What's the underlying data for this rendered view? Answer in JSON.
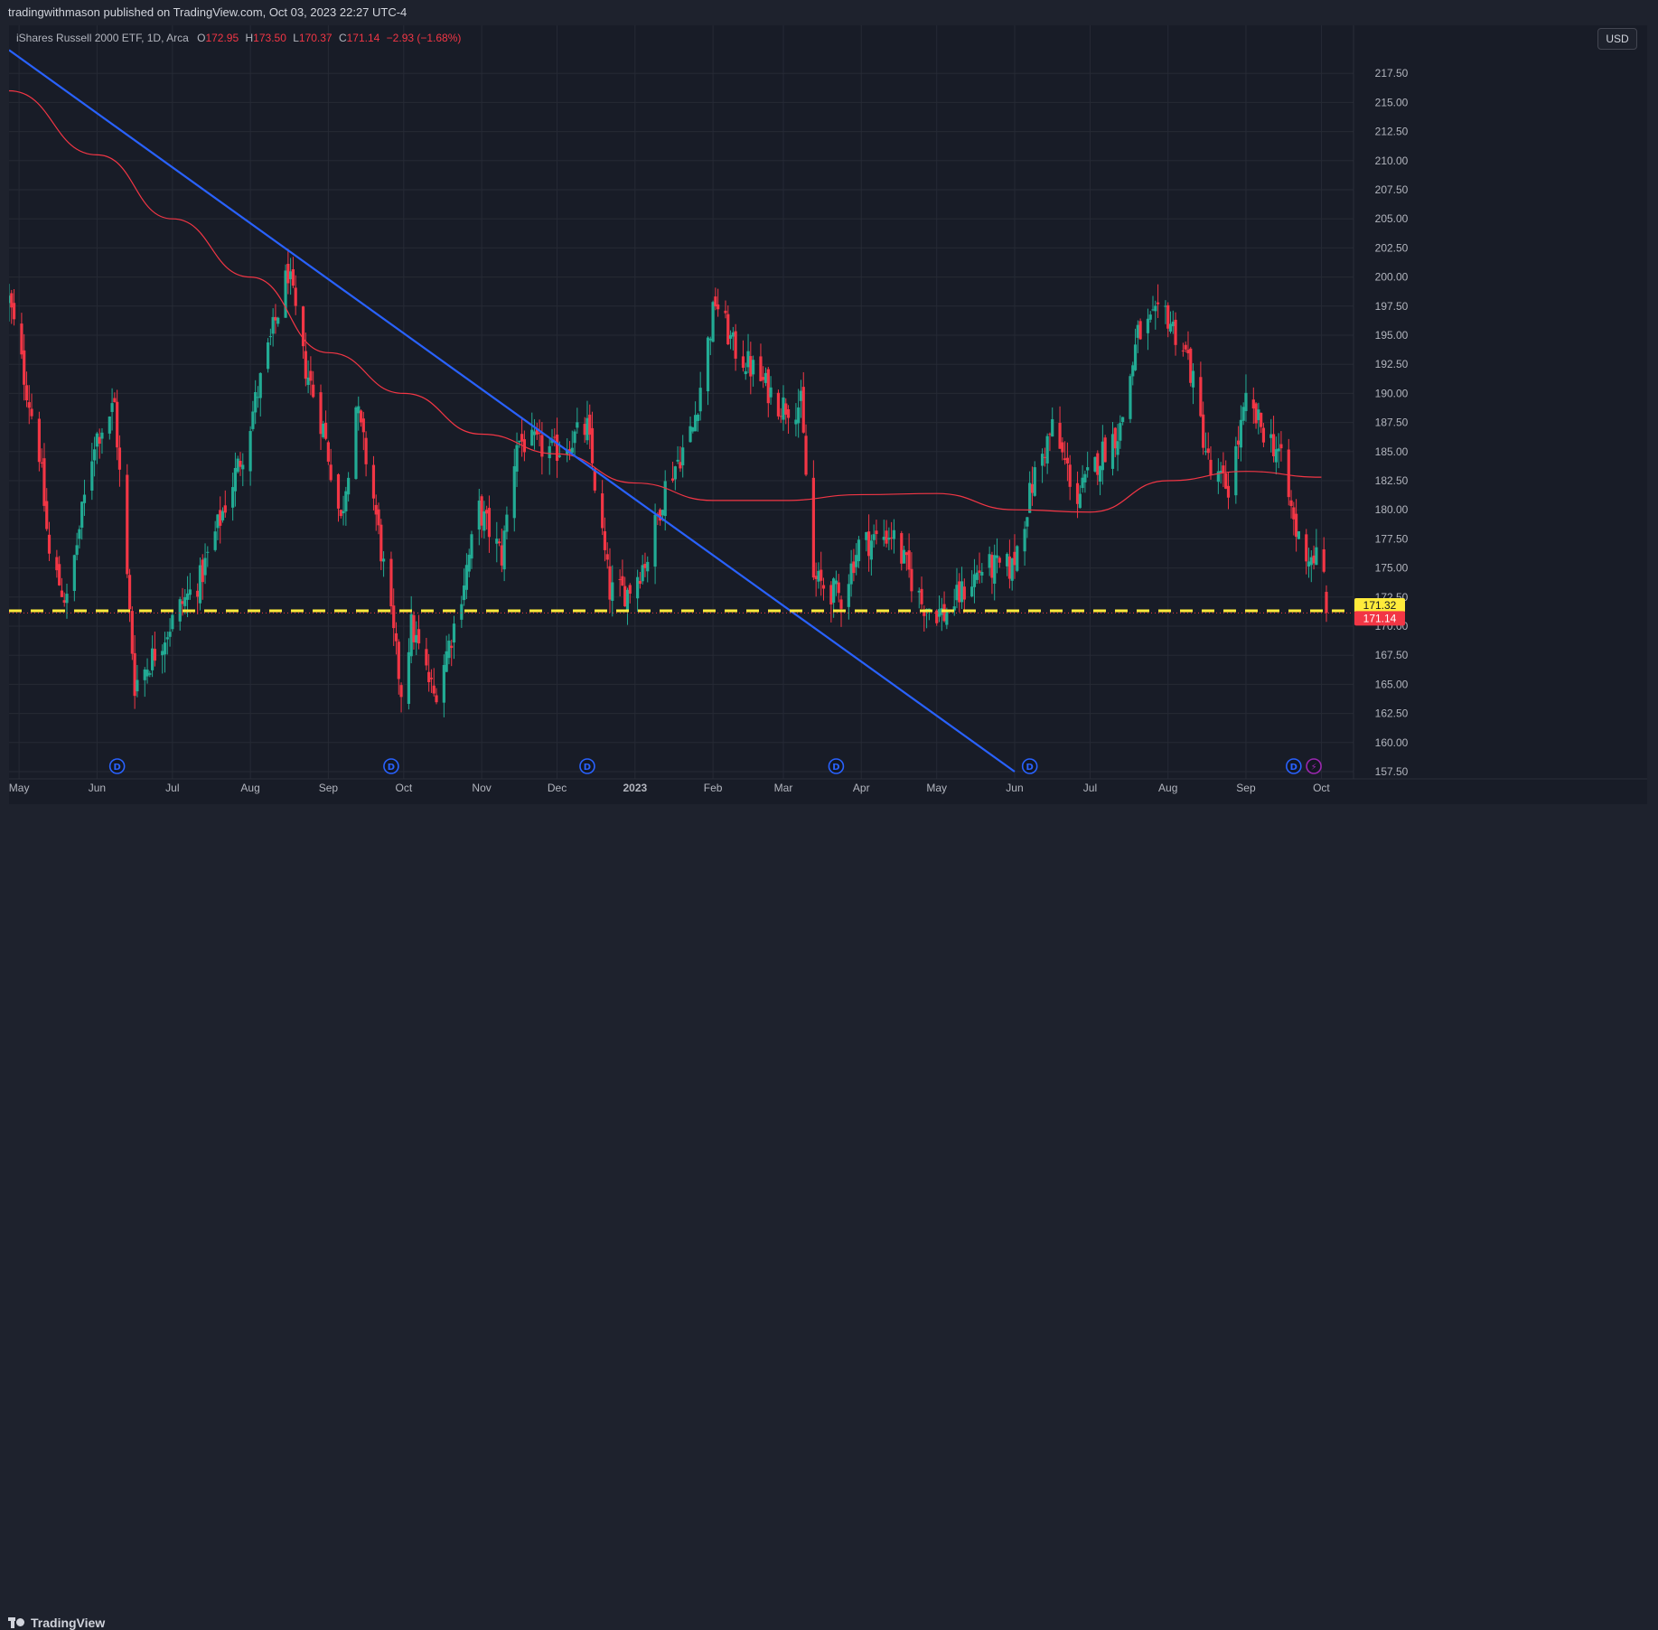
{
  "header": {
    "published": "tradingwithmason published on TradingView.com, Oct 03, 2023 22:27 UTC-4"
  },
  "legend": {
    "symbol": "iShares Russell 2000 ETF, 1D, Arca",
    "o_label": "O",
    "o_value": "172.95",
    "h_label": "H",
    "h_value": "173.50",
    "l_label": "L",
    "l_value": "170.37",
    "c_label": "C",
    "c_value": "171.14",
    "change": "−2.93 (−1.68%)"
  },
  "currency_button": "USD",
  "footer": {
    "brand": "TradingView"
  },
  "colors": {
    "up": "#22ab94",
    "down": "#f23645",
    "ma": "#f23645",
    "trendline": "#2962ff",
    "support": "#ffeb3b",
    "badge_dividend": "#2962ff",
    "badge_event": "#9c27b0",
    "background": "#181c27",
    "grid": "#262a35"
  },
  "chart_data": {
    "type": "candlestick",
    "symbol": "iShares Russell 2000 ETF, 1D, Arca",
    "ylim": [
      157.5,
      220
    ],
    "y_ticks": [
      "217.50",
      "215.00",
      "212.50",
      "210.00",
      "207.50",
      "205.00",
      "202.50",
      "200.00",
      "197.50",
      "195.00",
      "192.50",
      "190.00",
      "187.50",
      "185.00",
      "182.50",
      "180.00",
      "177.50",
      "175.00",
      "172.50",
      "170.00",
      "167.50",
      "165.00",
      "162.50",
      "160.00",
      "157.50"
    ],
    "x_labels": [
      "May",
      "Jun",
      "Jul",
      "Aug",
      "Sep",
      "Oct",
      "Nov",
      "Dec",
      "2023",
      "Feb",
      "Mar",
      "Apr",
      "May",
      "Jun",
      "Jul",
      "Aug",
      "Sep",
      "Oct"
    ],
    "last_ohlc": {
      "open": 172.95,
      "high": 173.5,
      "low": 170.37,
      "close": 171.14
    },
    "price_labels": [
      {
        "value": 171.32,
        "text": "171.32",
        "color": "#ffeb3b"
      },
      {
        "value": 171.14,
        "text": "171.14",
        "color": "#f23645"
      }
    ],
    "support_level": 171.32,
    "trendline": {
      "start": {
        "date": "2022-04-27",
        "price": 219.5
      },
      "end": {
        "date": "2023-06-01",
        "price": 157.5
      }
    },
    "moving_average_anchors": [
      [
        "2022-04-27",
        216.0
      ],
      [
        "2022-06-01",
        210.5
      ],
      [
        "2022-07-01",
        205.0
      ],
      [
        "2022-08-01",
        200.0
      ],
      [
        "2022-09-01",
        193.5
      ],
      [
        "2022-10-01",
        190.0
      ],
      [
        "2022-11-01",
        186.5
      ],
      [
        "2022-12-01",
        184.8
      ],
      [
        "2023-01-01",
        182.3
      ],
      [
        "2023-02-01",
        180.8
      ],
      [
        "2023-03-01",
        180.8
      ],
      [
        "2023-04-01",
        181.3
      ],
      [
        "2023-05-01",
        181.4
      ],
      [
        "2023-06-01",
        180.0
      ],
      [
        "2023-07-01",
        179.8
      ],
      [
        "2023-08-01",
        182.5
      ],
      [
        "2023-09-01",
        183.3
      ],
      [
        "2023-10-01",
        182.8
      ]
    ],
    "price_path": [
      [
        "2022-04-27",
        198
      ],
      [
        "2022-05-09",
        185
      ],
      [
        "2022-05-13",
        176
      ],
      [
        "2022-05-20",
        172
      ],
      [
        "2022-05-31",
        186
      ],
      [
        "2022-06-08",
        189
      ],
      [
        "2022-06-16",
        165
      ],
      [
        "2022-06-22",
        167
      ],
      [
        "2022-07-05",
        172
      ],
      [
        "2022-07-12",
        174
      ],
      [
        "2022-07-29",
        185
      ],
      [
        "2022-08-16",
        200.5
      ],
      [
        "2022-08-22",
        193
      ],
      [
        "2022-08-30",
        187
      ],
      [
        "2022-09-06",
        179
      ],
      [
        "2022-09-12",
        189
      ],
      [
        "2022-09-19",
        181
      ],
      [
        "2022-09-30",
        164.5
      ],
      [
        "2022-10-04",
        170
      ],
      [
        "2022-10-13",
        164
      ],
      [
        "2022-10-21",
        170
      ],
      [
        "2022-10-31",
        180
      ],
      [
        "2022-11-09",
        176
      ],
      [
        "2022-11-15",
        186
      ],
      [
        "2022-11-30",
        185
      ],
      [
        "2022-12-13",
        187
      ],
      [
        "2022-12-22",
        173
      ],
      [
        "2022-12-29",
        173
      ],
      [
        "2023-01-06",
        176
      ],
      [
        "2023-01-13",
        182
      ],
      [
        "2023-01-24",
        187
      ],
      [
        "2023-02-02",
        198
      ],
      [
        "2023-02-09",
        194
      ],
      [
        "2023-02-17",
        192
      ],
      [
        "2023-02-28",
        189
      ],
      [
        "2023-03-08",
        189
      ],
      [
        "2023-03-13",
        174
      ],
      [
        "2023-03-24",
        172.5
      ],
      [
        "2023-03-31",
        177
      ],
      [
        "2023-04-13",
        178
      ],
      [
        "2023-04-25",
        172
      ],
      [
        "2023-05-04",
        171
      ],
      [
        "2023-05-19",
        175
      ],
      [
        "2023-05-31",
        175
      ],
      [
        "2023-06-09",
        183
      ],
      [
        "2023-06-16",
        187
      ],
      [
        "2023-06-26",
        181
      ],
      [
        "2023-07-06",
        185
      ],
      [
        "2023-07-13",
        187
      ],
      [
        "2023-07-20",
        195
      ],
      [
        "2023-07-31",
        197
      ],
      [
        "2023-08-09",
        193
      ],
      [
        "2023-08-18",
        183
      ],
      [
        "2023-08-25",
        182
      ],
      [
        "2023-09-01",
        189
      ],
      [
        "2023-09-14",
        185
      ],
      [
        "2023-09-21",
        178
      ],
      [
        "2023-09-26",
        176
      ],
      [
        "2023-09-29",
        176
      ],
      [
        "2023-10-02",
        174
      ],
      [
        "2023-10-03",
        171.14
      ]
    ],
    "event_markers": [
      {
        "date": "2022-06-09",
        "label": "D",
        "kind": "dividend"
      },
      {
        "date": "2022-09-26",
        "label": "D",
        "kind": "dividend"
      },
      {
        "date": "2022-12-13",
        "label": "D",
        "kind": "dividend"
      },
      {
        "date": "2023-03-22",
        "label": "D",
        "kind": "dividend"
      },
      {
        "date": "2023-06-07",
        "label": "D",
        "kind": "dividend"
      },
      {
        "date": "2023-09-20",
        "label": "D",
        "kind": "dividend"
      },
      {
        "date": "2023-09-28",
        "label": "⚡",
        "kind": "event"
      }
    ]
  }
}
